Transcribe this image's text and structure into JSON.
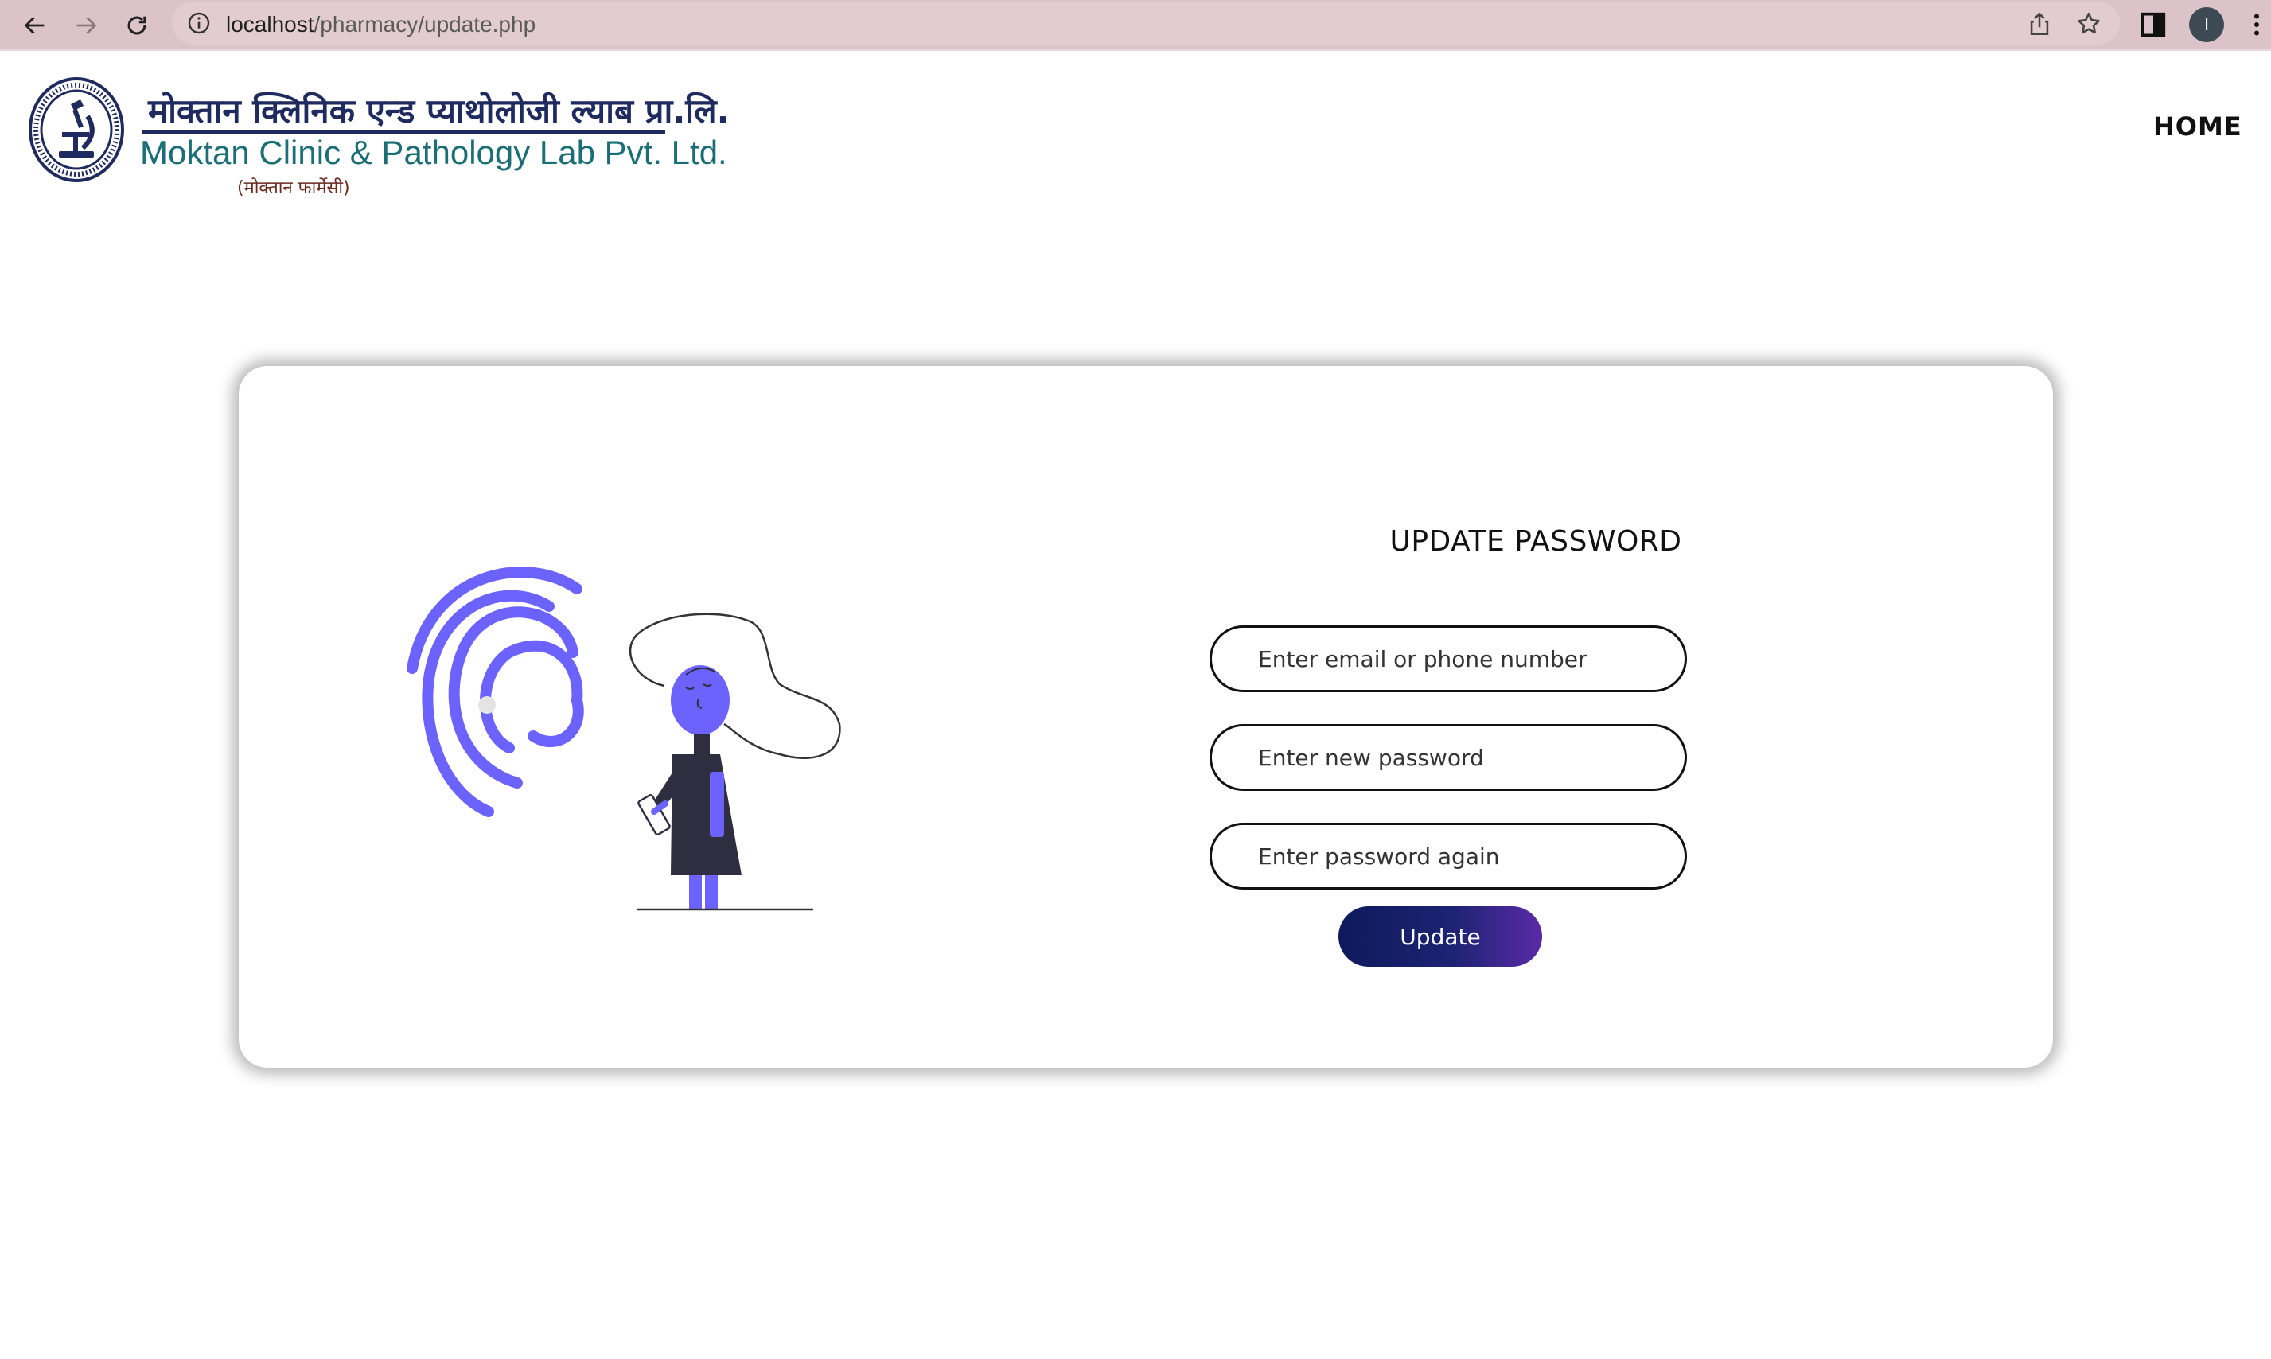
{
  "browser": {
    "url_host": "localhost",
    "url_path": "/pharmacy/update.php",
    "profile_initial": "I",
    "icons": [
      "back-arrow-icon",
      "forward-arrow-icon",
      "reload-icon",
      "info-icon",
      "share-icon",
      "star-icon",
      "side-panel-icon",
      "kebab-menu-icon"
    ]
  },
  "header": {
    "brand_nepali": "मोक्तान क्लिनिक एन्ड प्याथोलोजी ल्याब प्रा.लि.",
    "brand_english": "Moktan Clinic & Pathology Lab Pvt. Ltd.",
    "brand_sub": "(मोक्तान फार्मेसी)",
    "nav_home": "HOME"
  },
  "form": {
    "title": "UPDATE PASSWORD",
    "email_placeholder": "Enter email or phone number",
    "new_password_placeholder": "Enter new password",
    "confirm_password_placeholder": "Enter password again",
    "submit_label": "Update"
  },
  "colors": {
    "chrome_bg": "#dcc3ca",
    "accent_purple": "#6c63ff",
    "brand_navy": "#1f2a5e",
    "brand_teal": "#1b6e76",
    "button_start": "#0e1a5c",
    "button_end": "#5a2aa6"
  }
}
